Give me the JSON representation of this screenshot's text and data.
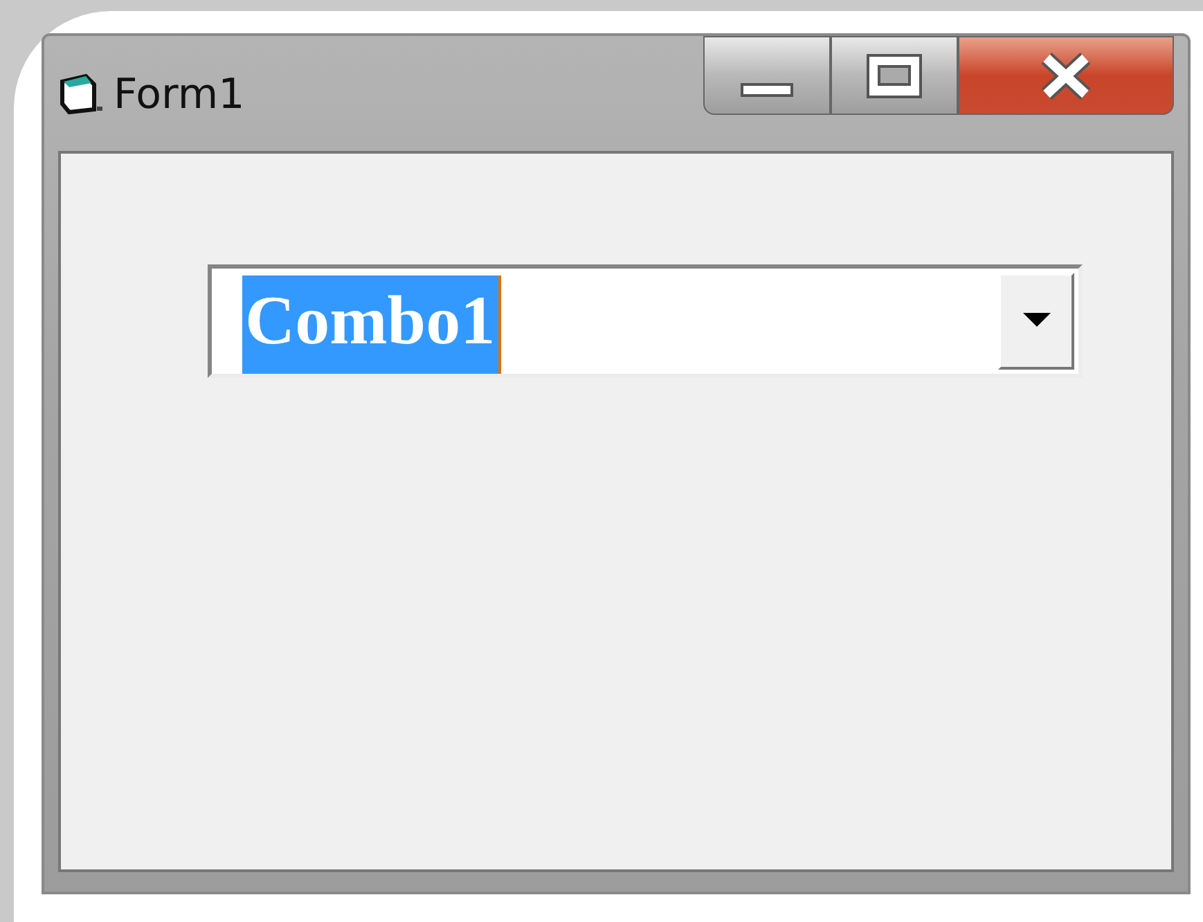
{
  "window": {
    "title": "Form1"
  },
  "combo": {
    "value": "Combo1",
    "selected": true
  }
}
